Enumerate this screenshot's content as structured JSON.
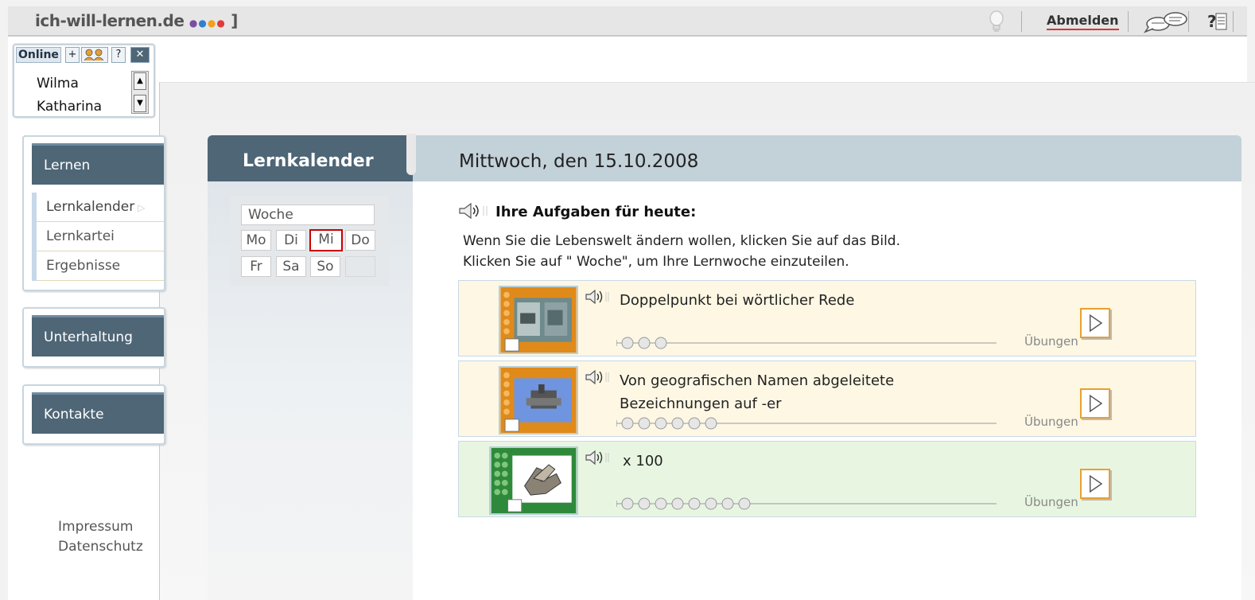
{
  "header": {
    "logo": "ich-will-lernen.de",
    "logo_dots": "●●●●",
    "logo_bracket": "]",
    "logout_label": "Abmelden",
    "icons": [
      "lightbulb-icon",
      "chat-icon",
      "help-icon"
    ]
  },
  "online": {
    "label": "Online",
    "buttons": [
      "+",
      "?",
      "✕"
    ],
    "users": [
      "Wilma",
      "Katharina"
    ]
  },
  "nav": {
    "lernen": {
      "title": "Lernen",
      "items": [
        "Lernkalender",
        "Lernkartei",
        "Ergebnisse"
      ]
    },
    "unterhaltung": {
      "title": "Unterhaltung"
    },
    "kontakte": {
      "title": "Kontakte"
    }
  },
  "footer": {
    "impressum": "Impressum",
    "datenschutz": "Datenschutz"
  },
  "calendar": {
    "title": "Lernkalender",
    "week_label": "Woche",
    "days": [
      "Mo",
      "Di",
      "Mi",
      "Do",
      "Fr",
      "Sa",
      "So"
    ],
    "selected_day": "Mi"
  },
  "day": {
    "date_heading": "Mittwoch, den 15.10.2008",
    "tasks_title": "Ihre Aufgaben für heute:",
    "instruction_1": "Wenn Sie die Lebenswelt ändern wollen, klicken Sie auf das Bild.",
    "instruction_2": "Klicken Sie auf \" Woche\", um Ihre Lernwoche einzuteilen."
  },
  "tasks": [
    {
      "line1": "Doppelpunkt bei wörtlicher Rede",
      "line2": "",
      "progress_label": "Übungen",
      "exercises": 3,
      "color": "yellow"
    },
    {
      "line1": "Von geografischen Namen abgeleitete",
      "line2": "Bezeichnungen auf -er",
      "progress_label": "Übungen",
      "exercises": 6,
      "color": "yellow"
    },
    {
      "line1": " x 100",
      "line2": "",
      "progress_label": "Übungen",
      "exercises": 8,
      "color": "green"
    }
  ],
  "colors": {
    "nav_header": "#4e6676",
    "date_header": "#c3d1d9",
    "task_yellow": "#fdf7e4",
    "task_green": "#e8f6e1",
    "play_border": "#e8a030",
    "selected_day": "#cc0000"
  }
}
